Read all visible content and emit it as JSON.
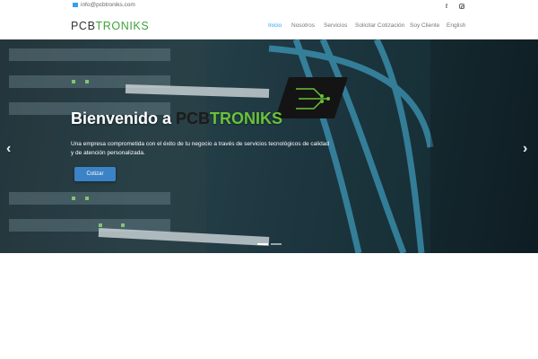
{
  "topbar": {
    "email": "info@pcbtroniks.com",
    "social": [
      {
        "icon": "facebook-icon",
        "glyph": "f"
      },
      {
        "icon": "instagram-icon",
        "glyph": ""
      }
    ]
  },
  "header": {
    "logo_part1": "PCB",
    "logo_part2": "TRONIKS",
    "nav": [
      {
        "label": "Inicio",
        "active": true
      },
      {
        "label": "Nosotros",
        "active": false
      },
      {
        "label": "Servicios",
        "active": false
      },
      {
        "label": "Solicitar Cotización",
        "active": false
      },
      {
        "label": "Soy Cliente",
        "active": false
      },
      {
        "label": "English",
        "active": false
      }
    ]
  },
  "hero": {
    "title_prefix": "Bienvenido a ",
    "title_brand1": "PCB",
    "title_brand2": "TRONIKS",
    "text": "Una empresa comprometida con el éxito de tu negocio a través de servicios tecnológicos de calidad y de atención personalizada.",
    "button_label": "Cotizar",
    "arrow_left": "‹",
    "arrow_right": "›",
    "slides": 2,
    "active_slide": 1
  },
  "colors": {
    "accent": "#2ea3f2",
    "brand_green": "#3fa33c",
    "button": "#3b83c4"
  }
}
